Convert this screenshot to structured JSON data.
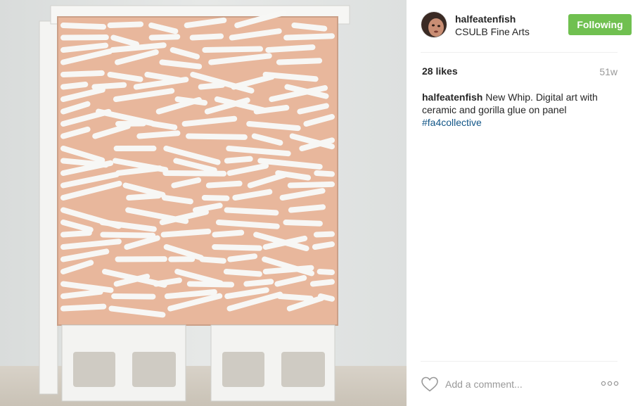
{
  "post": {
    "username": "halfeatenfish",
    "location": "CSULB Fine Arts",
    "follow_label": "Following",
    "likes": "28 likes",
    "age": "51w",
    "caption_user": "halfeatenfish",
    "caption_text": "New Whip. Digital art with ceramic and gorilla glue on panel",
    "hashtag": "#fa4collective"
  },
  "comment": {
    "placeholder": "Add a comment..."
  },
  "icons": {
    "like": "heart-outline-icon",
    "options": "ellipsis-icon"
  },
  "colors": {
    "follow_button": "#70c050",
    "hashtag": "#125688",
    "muted": "#999999"
  }
}
